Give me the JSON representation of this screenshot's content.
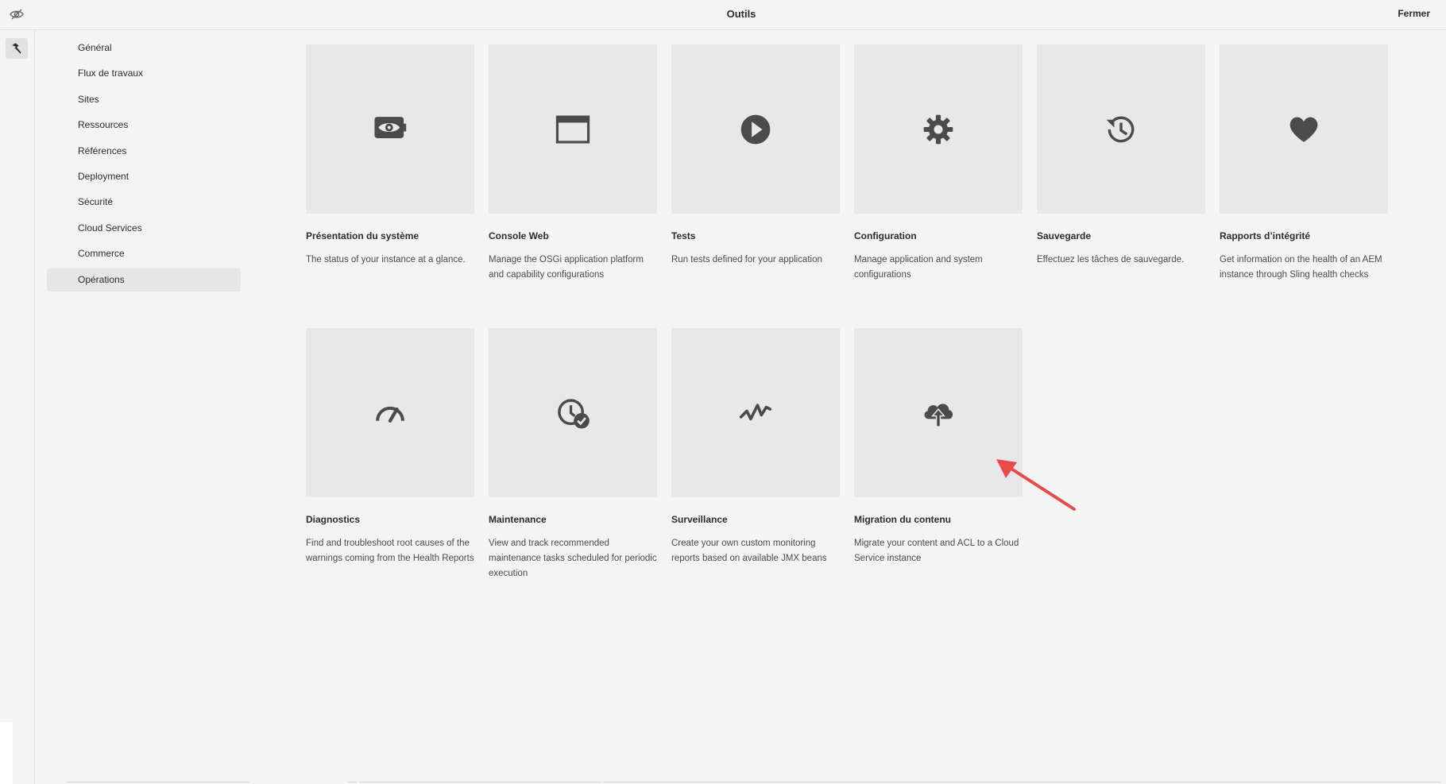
{
  "header": {
    "title": "Outils",
    "close_label": "Fermer"
  },
  "rail": {
    "logo_icon": "adobe-eye-slash-icon",
    "tools_icon": "hammer-icon"
  },
  "sidebar": {
    "items": [
      {
        "label": "Général",
        "active": false
      },
      {
        "label": "Flux de travaux",
        "active": false
      },
      {
        "label": "Sites",
        "active": false
      },
      {
        "label": "Ressources",
        "active": false
      },
      {
        "label": "Références",
        "active": false
      },
      {
        "label": "Deployment",
        "active": false
      },
      {
        "label": "Sécurité",
        "active": false
      },
      {
        "label": "Cloud Services",
        "active": false
      },
      {
        "label": "Commerce",
        "active": false
      },
      {
        "label": "Opérations",
        "active": true
      }
    ]
  },
  "cards": [
    {
      "icon": "monitor-eye-icon",
      "title": "Présentation du système",
      "description": "The status of your instance at a glance."
    },
    {
      "icon": "browser-window-icon",
      "title": "Console Web",
      "description": "Manage the OSGi application platform and capability configurations"
    },
    {
      "icon": "play-icon",
      "title": "Tests",
      "description": "Run tests defined for your application"
    },
    {
      "icon": "gear-icon",
      "title": "Configuration",
      "description": "Manage application and system configurations"
    },
    {
      "icon": "history-icon",
      "title": "Sauvegarde",
      "description": "Effectuez les tâches de sauvegarde."
    },
    {
      "icon": "heart-icon",
      "title": "Rapports d’intégrité",
      "description": "Get information on the health of an AEM instance through Sling health checks"
    },
    {
      "icon": "gauge-icon",
      "title": "Diagnostics",
      "description": "Find and troubleshoot root causes of the warnings coming from the Health Reports"
    },
    {
      "icon": "clock-check-icon",
      "title": "Maintenance",
      "description": "View and track recommended maintenance tasks scheduled for periodic execution"
    },
    {
      "icon": "activity-icon",
      "title": "Surveillance",
      "description": "Create your own custom monitoring reports based on available JMX beans"
    },
    {
      "icon": "cloud-upload-icon",
      "title": "Migration du contenu",
      "description": "Migrate your content and ACL to a Cloud Service instance"
    }
  ],
  "colors": {
    "background": "#f4f4f4",
    "card_thumb": "#e8e8e8",
    "icon": "#4b4b4b",
    "annotation_arrow": "#e84b4b"
  }
}
